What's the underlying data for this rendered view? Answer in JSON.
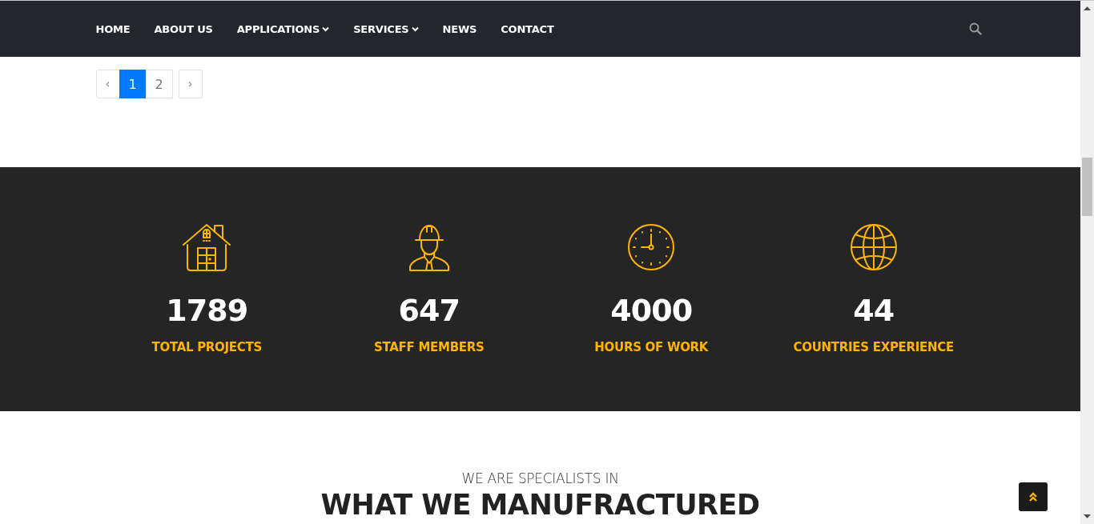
{
  "nav": {
    "items": [
      {
        "label": "HOME",
        "dropdown": false
      },
      {
        "label": "ABOUT US",
        "dropdown": false
      },
      {
        "label": "APPLICATIONS",
        "dropdown": true
      },
      {
        "label": "SERVICES",
        "dropdown": true
      },
      {
        "label": "NEWS",
        "dropdown": false
      },
      {
        "label": "CONTACT",
        "dropdown": false
      }
    ]
  },
  "pagination": {
    "previous": "‹",
    "pages": [
      {
        "label": "1",
        "selected": true
      },
      {
        "label": "2",
        "selected": false
      }
    ],
    "next": "›"
  },
  "stats": [
    {
      "kind": "house",
      "value": "1789",
      "label": "TOTAL PROJECTS"
    },
    {
      "kind": "worker",
      "value": "647",
      "label": "STAFF MEMBERS"
    },
    {
      "kind": "clock",
      "value": "4000",
      "label": "HOURS OF WORK"
    },
    {
      "kind": "globe",
      "value": "44",
      "label": "COUNTRIES EXPERIENCE"
    }
  ],
  "specialties": {
    "eyebrow": "WE ARE SPECIALISTS IN",
    "heading": "WHAT WE MANUFRACTURED"
  }
}
